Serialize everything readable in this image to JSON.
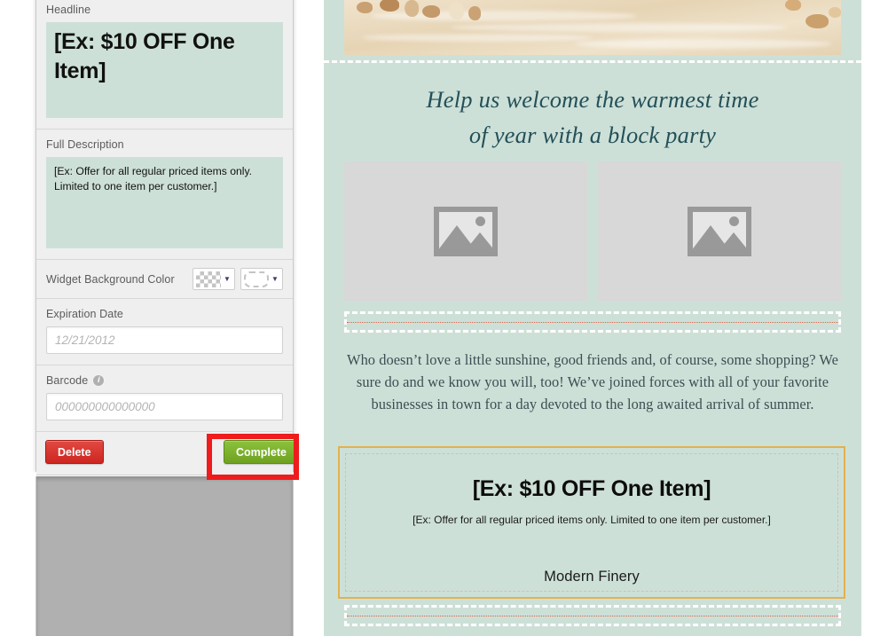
{
  "editor": {
    "headline": {
      "label": "Headline",
      "value": "[Ex: $10 OFF One Item]"
    },
    "description": {
      "label": "Full Description",
      "value": "[Ex: Offer for all regular priced items only. Limited to one item per customer.]"
    },
    "background_color": {
      "label": "Widget Background Color",
      "swatch_primary": "checkerboard-transparent",
      "swatch_secondary": "dashed-border-pattern",
      "caret": "▼"
    },
    "expiration": {
      "label": "Expiration Date",
      "placeholder": "12/21/2012"
    },
    "barcode": {
      "label": "Barcode",
      "info_icon_glyph": "i",
      "placeholder": "000000000000000"
    },
    "actions": {
      "delete_label": "Delete",
      "complete_label": "Complete"
    },
    "colors": {
      "panel_bg": "#efefef",
      "mint_field": "#cde0d7",
      "delete_red": "#cf2520",
      "complete_green": "#7fb22e",
      "highlight_red": "#ee1c1c",
      "overlay_gray": "#b0b0b0"
    }
  },
  "preview": {
    "banner_alt": "sand-with-seashells-banner",
    "heading_line1": "Help us welcome the warmest time",
    "heading_line2": "of year with a block party",
    "image_slots": [
      {
        "icon": "picture-placeholder-icon"
      },
      {
        "icon": "picture-placeholder-icon"
      }
    ],
    "body": "Who doesn’t love a little sunshine, good friends and, of course, some shopping? We sure do and we know you will, too! We’ve joined forces with all of your favorite businesses in town for a day devoted to the long awaited arrival of summer.",
    "coupon": {
      "headline": "[Ex: $10 OFF One Item]",
      "description": "[Ex: Offer for all regular priced items only. Limited to one item per customer.]",
      "business_name": "Modern Finery"
    },
    "colors": {
      "background": "#cde0d7",
      "heading_text": "#235059",
      "body_text": "#3b4f53",
      "coupon_border": "#e3b14e",
      "image_slot_bg": "#d8d8d8",
      "dropzone_dash": "#ffffff",
      "dropzone_line": "#d9654a"
    }
  }
}
